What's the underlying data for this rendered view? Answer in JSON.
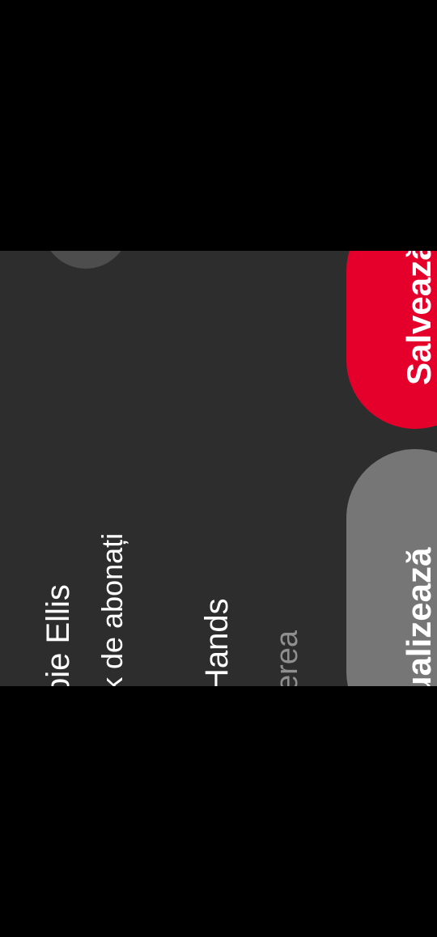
{
  "profile": {
    "name": "bie Ellis",
    "subscribers": "k de abonați",
    "channel": "Hands",
    "hint": "erea"
  },
  "actions": {
    "save_label": "Salvează",
    "view_label": "Vizualizează"
  },
  "colors": {
    "panel_bg": "#2d2d2d",
    "save_button": "#e5002b",
    "view_button": "#767676",
    "hint_text": "#8f8f8f"
  }
}
